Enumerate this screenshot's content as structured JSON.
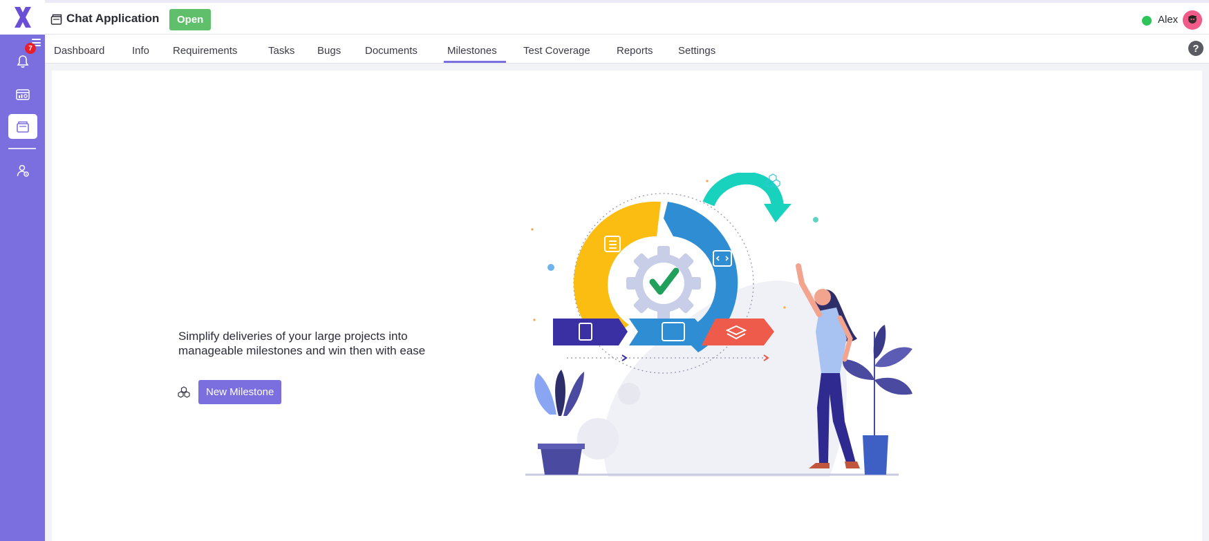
{
  "app": {
    "project_title": "Chat Application",
    "status": "Open",
    "user_name": "Alex",
    "notification_count": "7"
  },
  "tabs": [
    {
      "label": "Dashboard"
    },
    {
      "label": "Info"
    },
    {
      "label": "Requirements"
    },
    {
      "label": "Tasks"
    },
    {
      "label": "Bugs"
    },
    {
      "label": "Documents"
    },
    {
      "label": "Milestones",
      "active": true
    },
    {
      "label": "Test Coverage"
    },
    {
      "label": "Reports"
    },
    {
      "label": "Settings"
    }
  ],
  "help": {
    "label": "?"
  },
  "empty_state": {
    "headline_line1": "Simplify deliveries of your large projects into",
    "headline_line2": "manageable milestones and win then with ease",
    "button_label": "New Milestone"
  },
  "colors": {
    "accent": "#7b6fe0",
    "status_green": "#5fbf6a",
    "online": "#2fc45a",
    "badge_red": "#e8202b"
  },
  "icons": {
    "sidebar": [
      "bell-icon",
      "dashboard-icon",
      "project-icon",
      "user-settings-icon"
    ],
    "header": [
      "project-icon",
      "avatar"
    ],
    "content": [
      "blocks-icon"
    ]
  }
}
